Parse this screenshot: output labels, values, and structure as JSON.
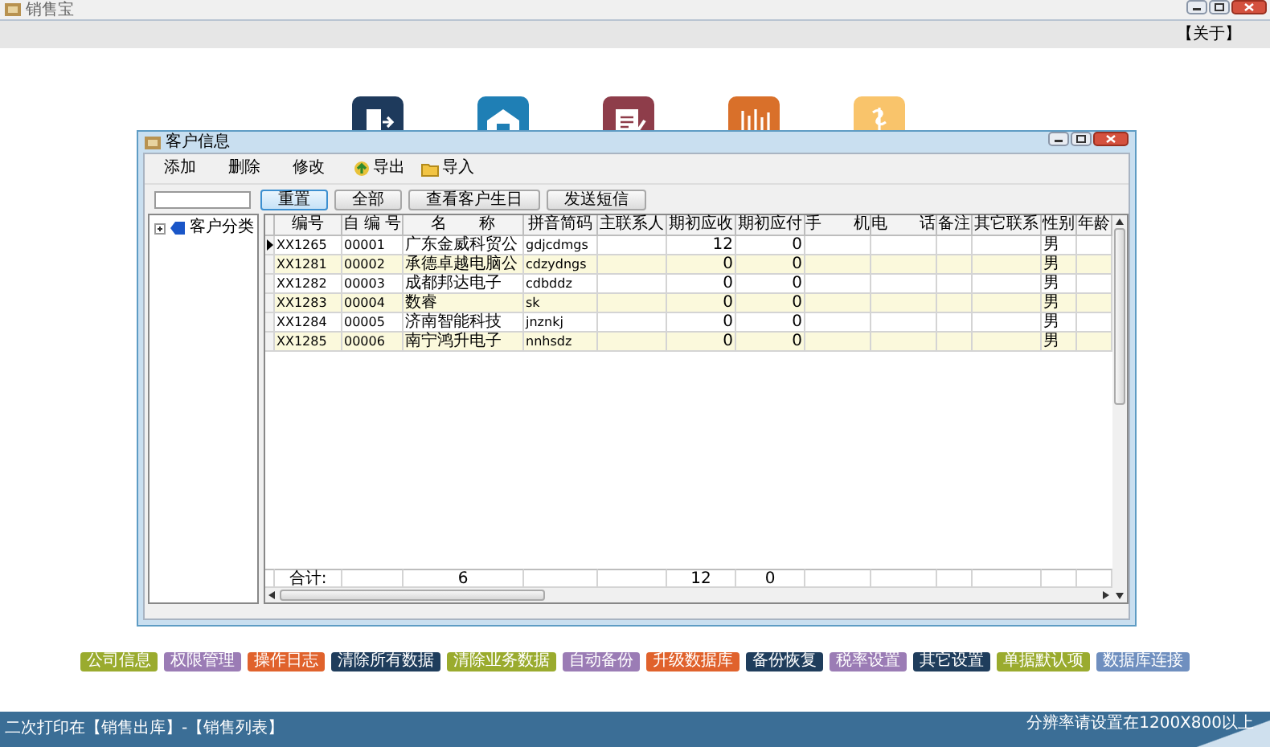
{
  "app": {
    "title": "销售宝"
  },
  "menu_band": {
    "about": "【关于】"
  },
  "tiles": [
    {
      "color": "#1e3a5c"
    },
    {
      "color": "#1f7fb5"
    },
    {
      "color": "#8e3d4a"
    },
    {
      "color": "#d9702a"
    },
    {
      "color": "#f9c46b"
    }
  ],
  "dialog": {
    "title": "客户信息",
    "toolbar": [
      {
        "label": "添加",
        "kind": "plain"
      },
      {
        "label": "删除",
        "kind": "plain"
      },
      {
        "label": "修改",
        "kind": "plain"
      },
      {
        "label": "导出",
        "kind": "export"
      },
      {
        "label": "导入",
        "kind": "import"
      }
    ],
    "search_buttons": [
      {
        "label": "重置",
        "focused": true
      },
      {
        "label": "全部",
        "focused": false
      },
      {
        "label": "查看客户生日",
        "focused": false
      },
      {
        "label": "发送短信",
        "focused": false
      }
    ],
    "tree": [
      {
        "label": "客户分类",
        "expanded": false
      }
    ],
    "table": {
      "columns": [
        "编号",
        "自 编 号",
        "名　　称",
        "拼音简码",
        "主联系人",
        "期初应收",
        "期初应付",
        "手　　机",
        "电　　话",
        "备注",
        "其它联系",
        "性别",
        "年龄"
      ],
      "rows": [
        {
          "selected": true,
          "id": "XX1265",
          "code": "00001",
          "name": "广东金威科贸公",
          "pinyin": "gdjcdmgs",
          "receivable": "12",
          "payable": "0",
          "gender": "男"
        },
        {
          "selected": false,
          "id": "XX1281",
          "code": "00002",
          "name": "承德卓越电脑公",
          "pinyin": "cdzydngs",
          "receivable": "0",
          "payable": "0",
          "gender": "男"
        },
        {
          "selected": false,
          "id": "XX1282",
          "code": "00003",
          "name": "成都邦达电子",
          "pinyin": "cdbddz",
          "receivable": "0",
          "payable": "0",
          "gender": "男"
        },
        {
          "selected": false,
          "id": "XX1283",
          "code": "00004",
          "name": "数睿",
          "pinyin": "sk",
          "receivable": "0",
          "payable": "0",
          "gender": "男"
        },
        {
          "selected": false,
          "id": "XX1284",
          "code": "00005",
          "name": "济南智能科技",
          "pinyin": "jnznkj",
          "receivable": "0",
          "payable": "0",
          "gender": "男"
        },
        {
          "selected": false,
          "id": "XX1285",
          "code": "00006",
          "name": "南宁鸿升电子",
          "pinyin": "nnhsdz",
          "receivable": "0",
          "payable": "0",
          "gender": "男"
        }
      ],
      "totals": {
        "label": "合计:",
        "name": "6",
        "receivable": "12",
        "payable": "0"
      }
    }
  },
  "function_buttons": [
    {
      "label": "公司信息",
      "color": "#9aab2e"
    },
    {
      "label": "权限管理",
      "color": "#9b7cb5"
    },
    {
      "label": "操作日志",
      "color": "#e0622c"
    },
    {
      "label": "清除所有数据",
      "color": "#1f3d5c"
    },
    {
      "label": "清除业务数据",
      "color": "#9aab2e"
    },
    {
      "label": "自动备份",
      "color": "#9b7cb5"
    },
    {
      "label": "升级数据库",
      "color": "#e0622c"
    },
    {
      "label": "备份恢复",
      "color": "#1f3d5c"
    },
    {
      "label": "税率设置",
      "color": "#9b7cb5"
    },
    {
      "label": "其它设置",
      "color": "#1f3d5c"
    },
    {
      "label": "单据默认项",
      "color": "#9aab2e"
    },
    {
      "label": "数据库连接",
      "color": "#6f8fbf"
    }
  ],
  "status_bar": {
    "left": "二次打印在【销售出库】-【销售列表】",
    "right": "分辨率请设置在1200X800以上"
  }
}
